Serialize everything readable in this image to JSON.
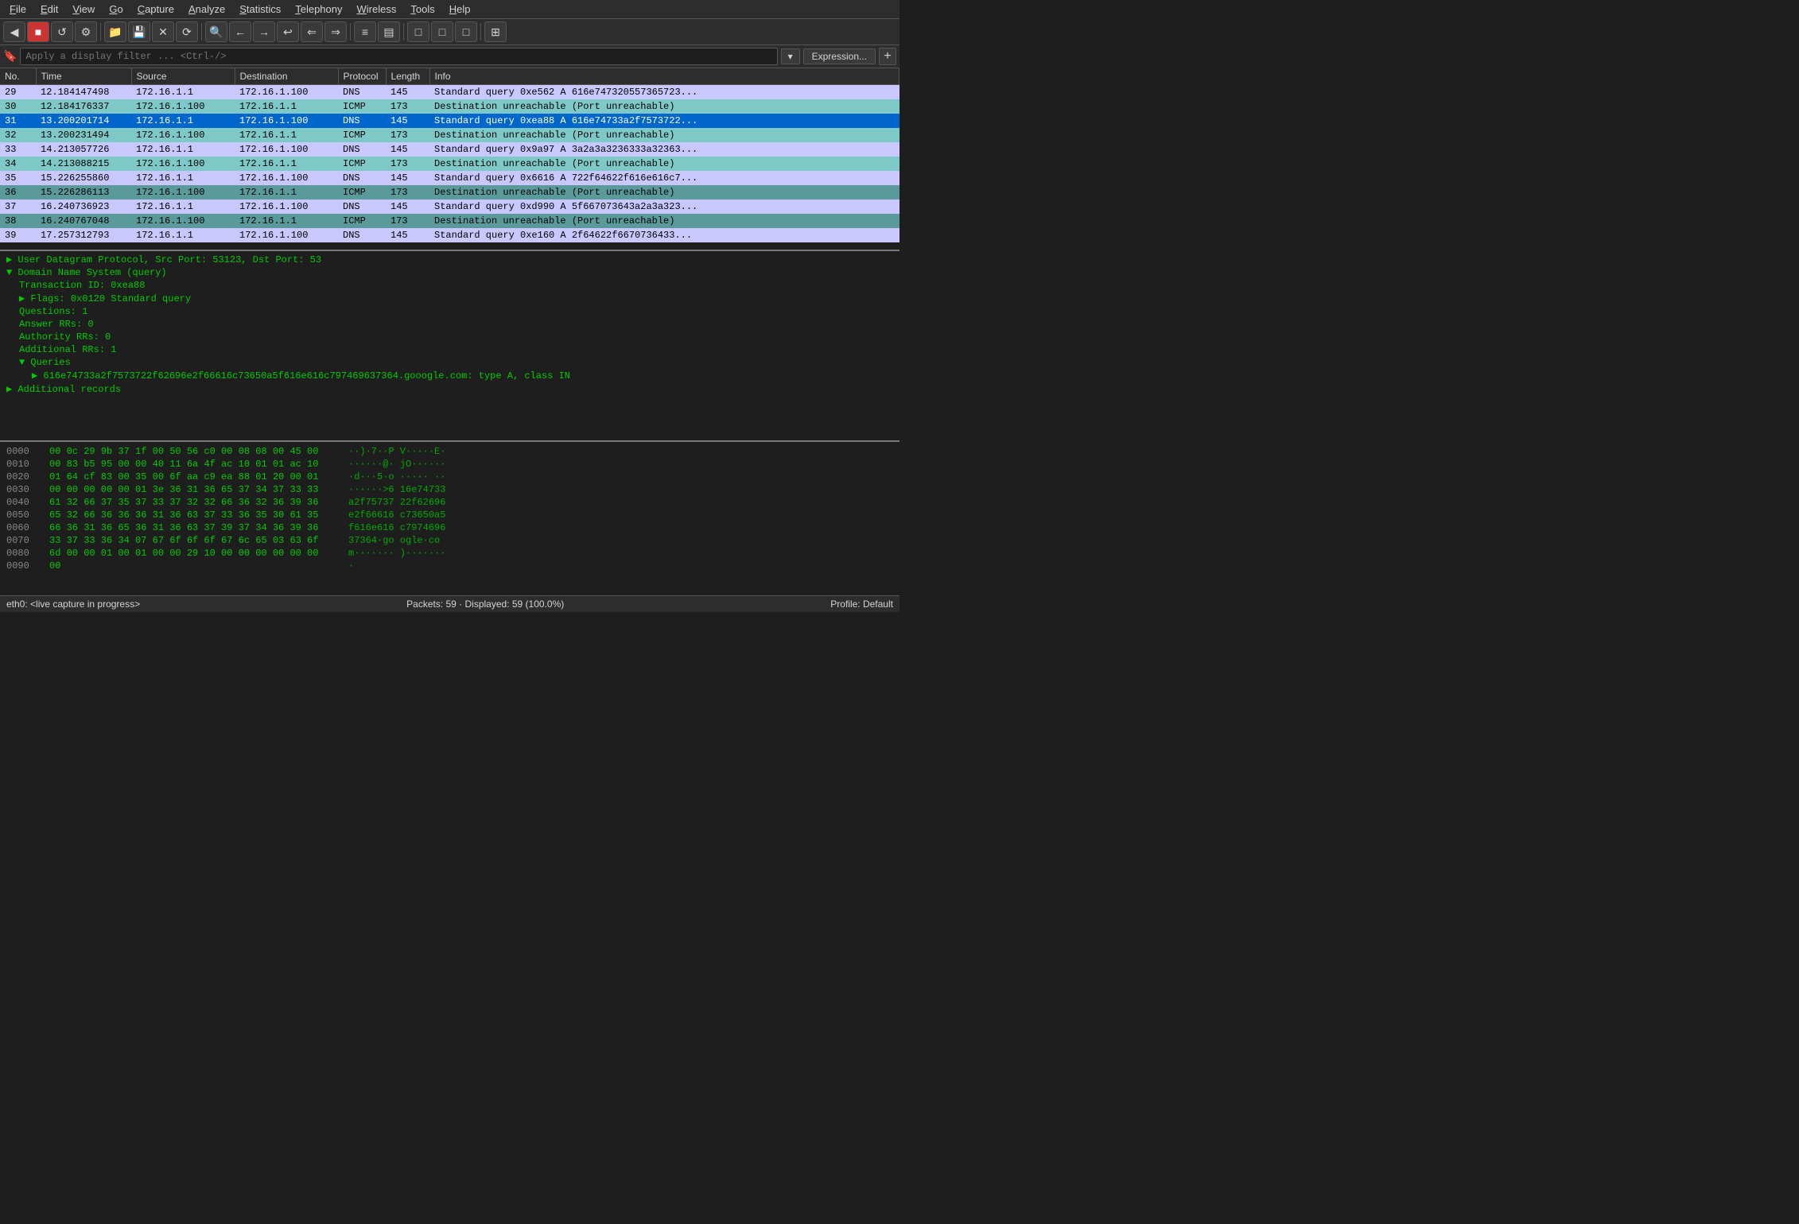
{
  "menubar": {
    "items": [
      {
        "label": "File",
        "underline": "F"
      },
      {
        "label": "Edit",
        "underline": "E"
      },
      {
        "label": "View",
        "underline": "V"
      },
      {
        "label": "Go",
        "underline": "G"
      },
      {
        "label": "Capture",
        "underline": "C"
      },
      {
        "label": "Analyze",
        "underline": "A"
      },
      {
        "label": "Statistics",
        "underline": "S"
      },
      {
        "label": "Telephony",
        "underline": "T"
      },
      {
        "label": "Wireless",
        "underline": "W"
      },
      {
        "label": "Tools",
        "underline": "T"
      },
      {
        "label": "Help",
        "underline": "H"
      }
    ]
  },
  "filter": {
    "placeholder": "Apply a display filter ... <Ctrl-/>",
    "expression_label": "Expression...",
    "plus_label": "+"
  },
  "table": {
    "headers": [
      "No.",
      "Time",
      "Source",
      "Destination",
      "Protocol",
      "Length",
      "Info"
    ],
    "rows": [
      {
        "no": "29",
        "time": "12.184147498",
        "src": "172.16.1.1",
        "dst": "172.16.1.100",
        "proto": "DNS",
        "len": "145",
        "info": "Standard query 0xe562 A 616e747320557365723...",
        "style": "dns"
      },
      {
        "no": "30",
        "time": "12.184176337",
        "src": "172.16.1.100",
        "dst": "172.16.1.1",
        "proto": "ICMP",
        "len": "173",
        "info": "Destination unreachable (Port unreachable)",
        "style": "icmp-alt"
      },
      {
        "no": "31",
        "time": "13.200201714",
        "src": "172.16.1.1",
        "dst": "172.16.1.100",
        "proto": "DNS",
        "len": "145",
        "info": "Standard query 0xea88 A 616e74733a2f7573722...",
        "style": "selected"
      },
      {
        "no": "32",
        "time": "13.200231494",
        "src": "172.16.1.100",
        "dst": "172.16.1.1",
        "proto": "ICMP",
        "len": "173",
        "info": "Destination unreachable (Port unreachable)",
        "style": "icmp-alt"
      },
      {
        "no": "33",
        "time": "14.213057726",
        "src": "172.16.1.1",
        "dst": "172.16.1.100",
        "proto": "DNS",
        "len": "145",
        "info": "Standard query 0x9a97 A 3a2a3a3236333a32363...",
        "style": "dns"
      },
      {
        "no": "34",
        "time": "14.213088215",
        "src": "172.16.1.100",
        "dst": "172.16.1.1",
        "proto": "ICMP",
        "len": "173",
        "info": "Destination unreachable (Port unreachable)",
        "style": "icmp-alt"
      },
      {
        "no": "35",
        "time": "15.226255860",
        "src": "172.16.1.1",
        "dst": "172.16.1.100",
        "proto": "DNS",
        "len": "145",
        "info": "Standard query 0x6616 A 722f64622f616e616c7...",
        "style": "dns"
      },
      {
        "no": "36",
        "time": "15.226286113",
        "src": "172.16.1.100",
        "dst": "172.16.1.1",
        "proto": "ICMP",
        "len": "173",
        "info": "Destination unreachable (Port unreachable)",
        "style": "icmp-dark"
      },
      {
        "no": "37",
        "time": "16.240736923",
        "src": "172.16.1.1",
        "dst": "172.16.1.100",
        "proto": "DNS",
        "len": "145",
        "info": "Standard query 0xd990 A 5f667073643a2a3a323...",
        "style": "dns"
      },
      {
        "no": "38",
        "time": "16.240767048",
        "src": "172.16.1.100",
        "dst": "172.16.1.1",
        "proto": "ICMP",
        "len": "173",
        "info": "Destination unreachable (Port unreachable)",
        "style": "icmp-dark"
      },
      {
        "no": "39",
        "time": "17.257312793",
        "src": "172.16.1.1",
        "dst": "172.16.1.100",
        "proto": "DNS",
        "len": "145",
        "info": "Standard query 0xe160 A 2f64622f6670736433...",
        "style": "dns"
      }
    ]
  },
  "detail": {
    "lines": [
      {
        "text": "▶ User Datagram Protocol, Src Port: 53123, Dst Port: 53",
        "indent": 0,
        "expand": true
      },
      {
        "text": "▼ Domain Name System (query)",
        "indent": 0,
        "expand": false
      },
      {
        "text": "Transaction ID: 0xea88",
        "indent": 1
      },
      {
        "text": "▶ Flags: 0x0120 Standard query",
        "indent": 1,
        "expand": true
      },
      {
        "text": "Questions: 1",
        "indent": 1
      },
      {
        "text": "Answer RRs: 0",
        "indent": 1
      },
      {
        "text": "Authority RRs: 0",
        "indent": 1
      },
      {
        "text": "Additional RRs: 1",
        "indent": 1
      },
      {
        "text": "▼ Queries",
        "indent": 1,
        "expand": false
      },
      {
        "text": "▶ 616e74733a2f7573722f62696e2f66616c73650a5f616e616c797469637364.gooogle.com: type A, class IN",
        "indent": 2,
        "expand": true
      },
      {
        "text": "▶ Additional records",
        "indent": 0,
        "expand": true
      }
    ]
  },
  "hex": {
    "rows": [
      {
        "offset": "0000",
        "bytes": "00 0c 29 9b 37 1f 00 50  56 c0 00 08 08 00 45 00",
        "ascii": "··)·7··P V·····E·"
      },
      {
        "offset": "0010",
        "bytes": "00 83 b5 95 00 00 40 11  6a 4f ac 10 01 01 ac 10",
        "ascii": "······@· jO······"
      },
      {
        "offset": "0020",
        "bytes": "01 64 cf 83 00 35 00 6f  aa c9 ea 88 01 20 00 01",
        "ascii": "·d···5·o ····· ··"
      },
      {
        "offset": "0030",
        "bytes": "00 00 00 00 00 01 3e 36  31 36 65 37 34 37 33 33",
        "ascii": "······>6 16e74733"
      },
      {
        "offset": "0040",
        "bytes": "61 32 66 37 35 37 33 37  32 32 66 36 32 36 39 36",
        "ascii": "a2f75737 22f62696"
      },
      {
        "offset": "0050",
        "bytes": "65 32 66 36 36 36 31 36  63 37 33 36 35 30 61 35",
        "ascii": "e2f66616 c73650a5"
      },
      {
        "offset": "0060",
        "bytes": "66 36 31 36 65 36 31 36  63 37 39 37 34 36 39 36",
        "ascii": "f616e616 c7974696"
      },
      {
        "offset": "0070",
        "bytes": "33 37 33 36 34 07 67 6f  6f 6f 67 6c 65 03 63 6f",
        "ascii": "37364·go ogle·co"
      },
      {
        "offset": "0080",
        "bytes": "6d 00 00 01 00 01 00 00  29 10 00 00 00 00 00 00",
        "ascii": "m······· )·······"
      },
      {
        "offset": "0090",
        "bytes": "00",
        "ascii": "·"
      }
    ]
  },
  "statusbar": {
    "interface": "eth0: <live capture in progress>",
    "packets": "Packets: 59 · Displayed: 59 (100.0%)",
    "profile": "Profile: Default"
  }
}
